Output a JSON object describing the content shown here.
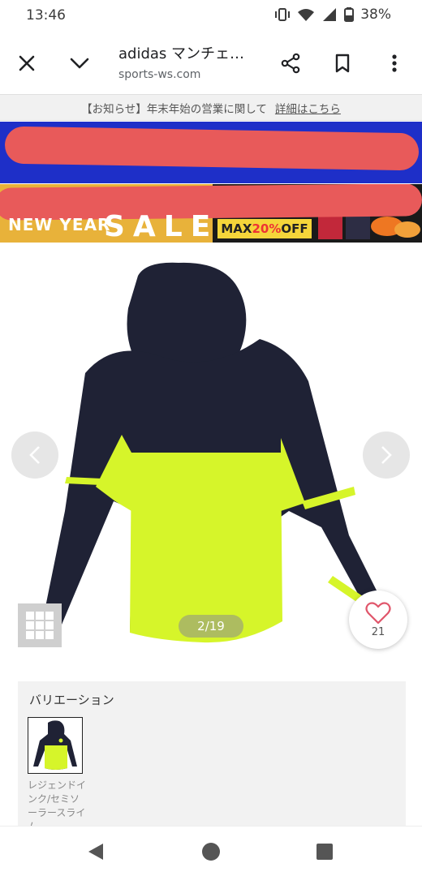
{
  "status": {
    "time": "13:46",
    "battery": "38%"
  },
  "toolbar": {
    "title": "adidas マンチェ…",
    "url": "sports-ws.com"
  },
  "notice": {
    "text": "【お知らせ】年末年始の営業に関して",
    "link": "詳細はこちら"
  },
  "banner": {
    "new_year": "NEW YEAR",
    "sale": "SALE",
    "max": "MAX",
    "pct": "20%",
    "off": "OFF"
  },
  "gallery": {
    "counter": "2/19",
    "likes": "21"
  },
  "variation": {
    "title": "バリエーション",
    "item_label": "レジェンドインク/セミソーラースライム"
  },
  "colors": {
    "jacket_navy": "#1f2235",
    "jacket_lime": "#d6f52a",
    "like_heart": "#e0566b"
  }
}
